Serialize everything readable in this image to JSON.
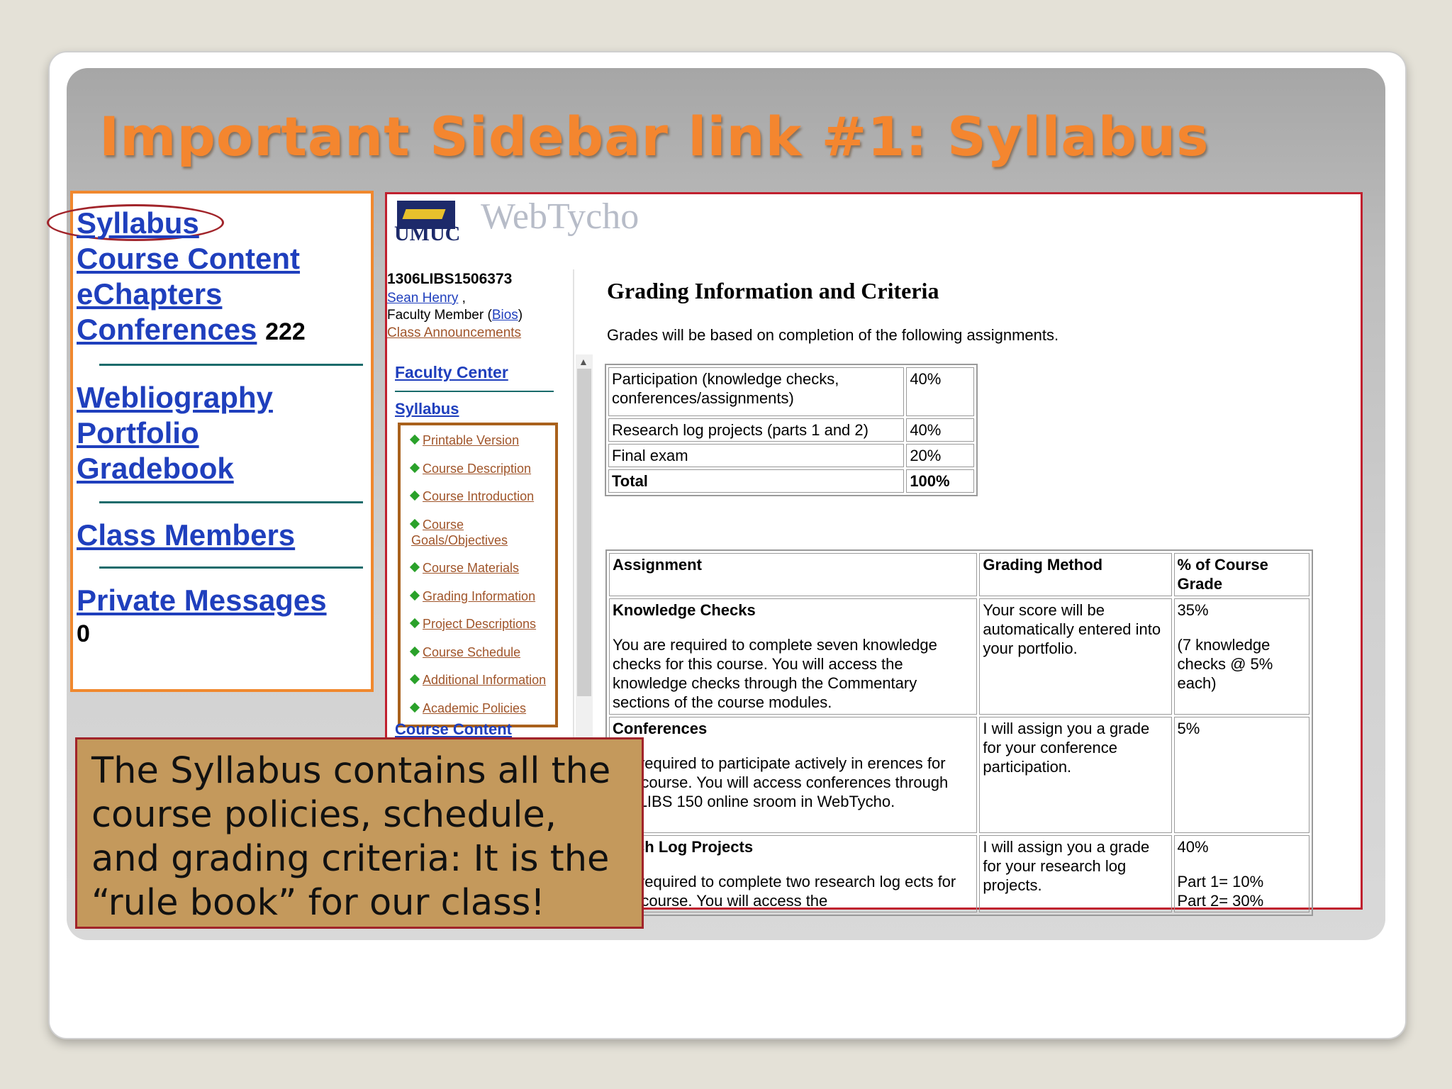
{
  "slide": {
    "title": "Important Sidebar link #1: Syllabus",
    "callout": "The Syllabus contains all the course policies, schedule, and grading criteria: It is the “rule book” for our class!"
  },
  "sidebar": {
    "syllabus": "Syllabus",
    "course_content": "Course Content",
    "echapters": "eChapters",
    "conferences": "Conferences",
    "conferences_count": "222",
    "webliography": "Webliography",
    "portfolio": "Portfolio",
    "gradebook": "Gradebook",
    "class_members": "Class Members",
    "private_messages": "Private Messages",
    "private_messages_count": "0"
  },
  "webtycho": {
    "logo_umuc": "UMUC",
    "logo_wordmark": "WebTycho",
    "course_id": "1306LIBS1506373",
    "instructor": "Sean Henry",
    "instructor_suffix": " ,",
    "faculty_prefix": "Faculty Member (",
    "bios": "Bios",
    "faculty_suffix": ")",
    "class_announcements": "Class Announcements",
    "faculty_center": "Faculty Center",
    "syllabus": "Syllabus",
    "course_content": "Course Content",
    "syllabus_items": [
      "Printable Version",
      "Course Description",
      "Course Introduction",
      "Course Goals/Objectives",
      "Course Materials",
      "Grading Information",
      "Project Descriptions",
      "Course Schedule",
      "Additional Information",
      "Academic Policies"
    ]
  },
  "grading": {
    "title": "Grading Information and Criteria",
    "intro": "Grades will be based on completion of the following assignments.",
    "summary_rows": [
      {
        "item": "Participation (knowledge checks, conferences/assignments)",
        "pct": "40%"
      },
      {
        "item": "Research log projects (parts 1 and 2)",
        "pct": "40%"
      },
      {
        "item": "Final exam",
        "pct": "20%"
      },
      {
        "item": "Total",
        "pct": "100%"
      }
    ],
    "detail_headers": [
      "Assignment",
      "Grading Method",
      "% of Course Grade"
    ],
    "detail_rows": [
      {
        "name": "Knowledge Checks",
        "desc": "You are required to complete seven knowledge checks for this course. You will access the knowledge checks through the Commentary sections of the course modules.",
        "method": "Your score will be automatically entered into your portfolio.",
        "pct": "35%",
        "pct_note": "(7 knowledge checks @ 5% each)"
      },
      {
        "name": "Conferences",
        "desc": "are required to participate actively in erences for this course. You will access conferences through the LIBS 150 online sroom in WebTycho.",
        "method": "I will assign you a grade for your conference participation.",
        "pct": "5%",
        "pct_note": ""
      },
      {
        "name": "earch Log Projects",
        "desc": "are required to complete two research log ects for this course. You will access the",
        "method": "I will assign you a grade for your research log projects.",
        "pct": "40%",
        "pct_note": "Part 1= 10%\nPart 2= 30%"
      }
    ]
  }
}
